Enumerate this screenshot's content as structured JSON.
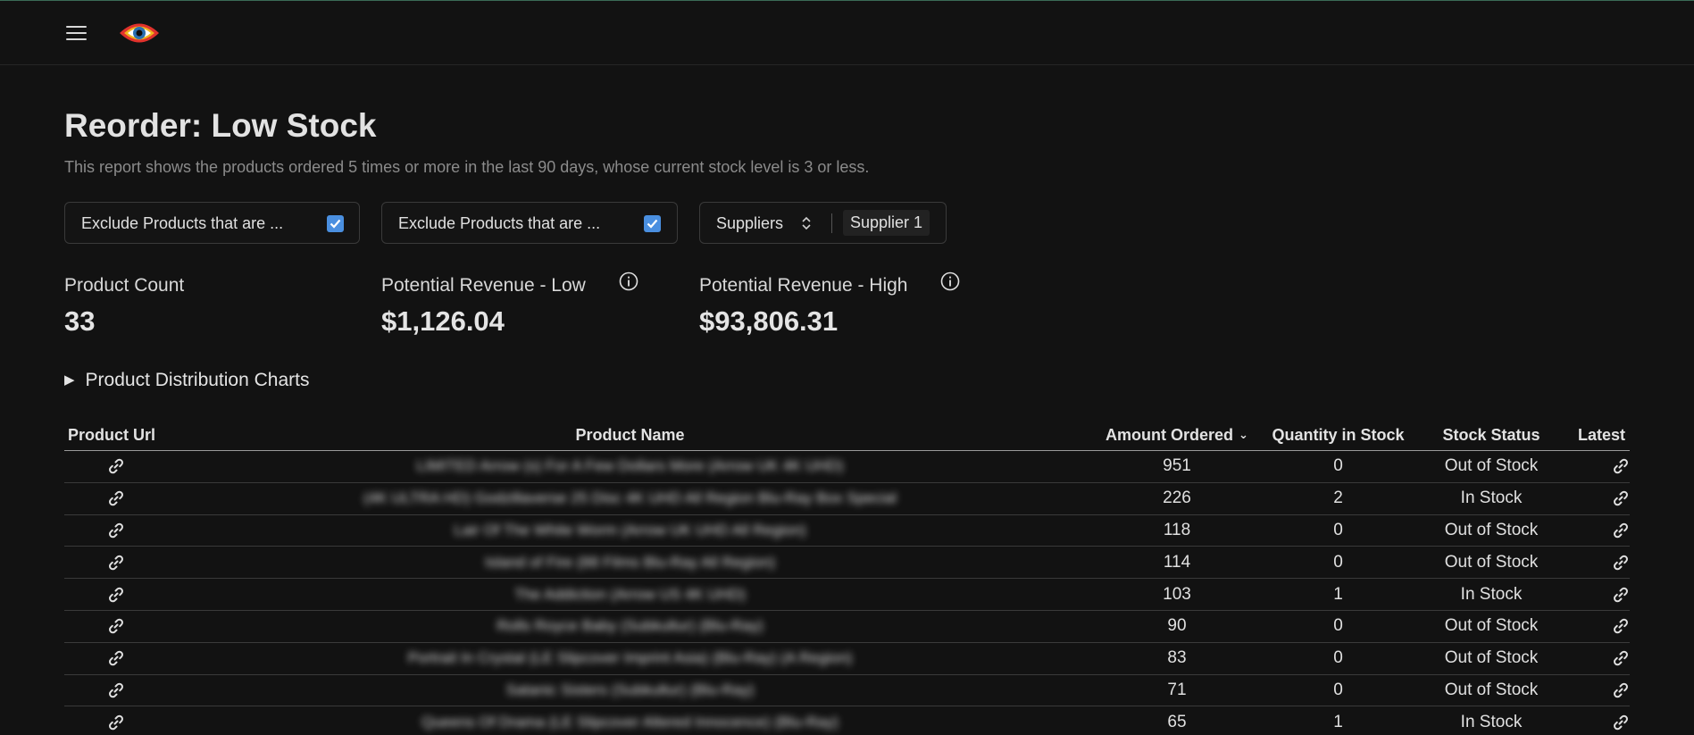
{
  "app": {
    "logo_icon": "eye-logo-icon",
    "menu_icon": "hamburger-menu-icon"
  },
  "page": {
    "title": "Reorder: Low Stock",
    "subtitle": "This report shows the products ordered 5 times or more in the last 90 days, whose current stock level is 3 or less."
  },
  "filters": {
    "exclude_1": {
      "label": "Exclude Products that are ...",
      "checked": true
    },
    "exclude_2": {
      "label": "Exclude Products that are ...",
      "checked": true
    },
    "suppliers": {
      "label": "Suppliers",
      "selected": "Supplier 1"
    }
  },
  "metrics": {
    "product_count": {
      "label": "Product Count",
      "value": "33"
    },
    "revenue_low": {
      "label": "Potential Revenue - Low",
      "value": "$1,126.04"
    },
    "revenue_high": {
      "label": "Potential Revenue - High",
      "value": "$93,806.31"
    }
  },
  "charts_section": {
    "label": "Product Distribution Charts",
    "expanded": false
  },
  "table": {
    "columns": {
      "url": "Product Url",
      "name": "Product Name",
      "amount": "Amount Ordered",
      "qty": "Quantity in Stock",
      "status": "Stock Status",
      "latest": "Latest Order Url"
    },
    "rows": [
      {
        "name": "LIMITED Arrow (s) For A Few Dollars More (Arrow UK 4K UHD)",
        "amount": "951",
        "qty": "0",
        "status": "Out of Stock"
      },
      {
        "name": "(4K ULTRA HD) Godzillaverse 25 Disc 4K UHD All Region Blu-Ray Box Special",
        "amount": "226",
        "qty": "2",
        "status": "In Stock"
      },
      {
        "name": "Lair Of The White Worm (Arrow UK UHD All Region)",
        "amount": "118",
        "qty": "0",
        "status": "Out of Stock"
      },
      {
        "name": "Island of Fire (88 Films Blu-Ray All Region)",
        "amount": "114",
        "qty": "0",
        "status": "Out of Stock"
      },
      {
        "name": "The Addiction (Arrow US 4K UHD)",
        "amount": "103",
        "qty": "1",
        "status": "In Stock"
      },
      {
        "name": "Rolls Royce Baby (Subkultur) (Blu-Ray)",
        "amount": "90",
        "qty": "0",
        "status": "Out of Stock"
      },
      {
        "name": "Portrait In Crystal (LE Slipcover Imprint Asia) (Blu-Ray) (A Region)",
        "amount": "83",
        "qty": "0",
        "status": "Out of Stock"
      },
      {
        "name": "Satanic Sisters (Subkultur) (Blu-Ray)",
        "amount": "71",
        "qty": "0",
        "status": "Out of Stock"
      },
      {
        "name": "Queens Of Drama (LE Slipcover Altered Innocence) (Blu-Ray)",
        "amount": "65",
        "qty": "1",
        "status": "In Stock"
      }
    ]
  },
  "colors": {
    "background": "#121212",
    "accent": "#4a8fe0",
    "logo_red": "#e0312c",
    "logo_yellow": "#f0b41c"
  }
}
